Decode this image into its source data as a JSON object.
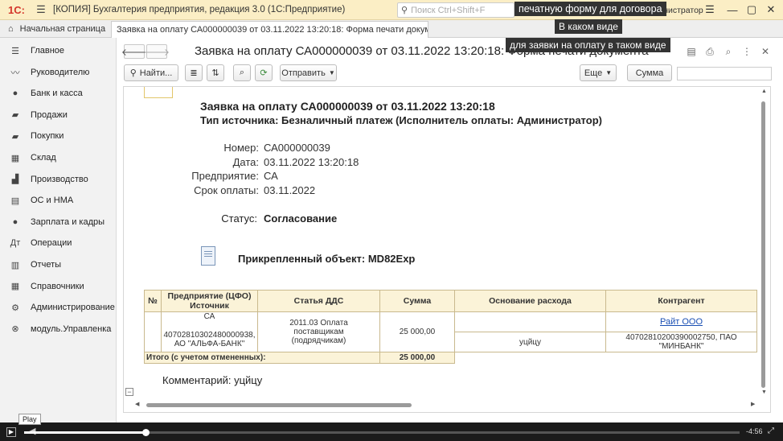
{
  "app": {
    "logo": "1С:",
    "window_title": "[КОПИЯ] Бухгалтерия предприятия, редакция 3.0  (1С:Предприятие)",
    "search_placeholder": "Поиск Ctrl+Shift+F",
    "user_label": "дминистратор"
  },
  "tabs": {
    "home": "Начальная страница",
    "document": "Заявка на оплату СА000000039 от 03.11.2022 13:20:18: Форма печати документа"
  },
  "sidebar": {
    "items": [
      {
        "label": "Главное",
        "icon": "☰"
      },
      {
        "label": "Руководителю",
        "icon": "〰"
      },
      {
        "label": "Банк и касса",
        "icon": "●"
      },
      {
        "label": "Продажи",
        "icon": "▰"
      },
      {
        "label": "Покупки",
        "icon": "▰"
      },
      {
        "label": "Склад",
        "icon": "▦"
      },
      {
        "label": "Производство",
        "icon": "▟"
      },
      {
        "label": "ОС и НМА",
        "icon": "▤"
      },
      {
        "label": "Зарплата и кадры",
        "icon": "●"
      },
      {
        "label": "Операции",
        "icon": "Дт"
      },
      {
        "label": "Отчеты",
        "icon": "▥"
      },
      {
        "label": "Справочники",
        "icon": "▦"
      },
      {
        "label": "Администрирование",
        "icon": "⚙"
      },
      {
        "label": "модуль.Управленка",
        "icon": "⊗"
      }
    ]
  },
  "form": {
    "title": "Заявка на оплату СА000000039 от 03.11.2022 13:20:18: Форма печати документа",
    "find_button": "Найти...",
    "send_button": "Отправить",
    "more_button": "Еще",
    "sum_button": "Сумма"
  },
  "report": {
    "heading": "Заявка на оплату СА000000039 от 03.11.2022 13:20:18",
    "subheading": "Тип источника: Безналичный платеж (Исполнитель оплаты: Администратор)",
    "fields": [
      {
        "label": "Номер:",
        "value": "СА000000039"
      },
      {
        "label": "Дата:",
        "value": "03.11.2022 13:20:18"
      },
      {
        "label": "Предприятие:",
        "value": "СА"
      },
      {
        "label": "Срок оплаты:",
        "value": "03.11.2022"
      }
    ],
    "status_label": "Статус:",
    "status_value": "Согласование",
    "attached_label": "Прикрепленный объект: MD82Exp",
    "table": {
      "headers": [
        "№",
        "Предприятие (ЦФО) Источник",
        "Статья ДДС",
        "Сумма",
        "Основание расхода",
        "Контрагент"
      ],
      "row": {
        "enterprise": "СА",
        "account": "40702810302480000938, АО \"АЛЬФА-БАНК\"",
        "article": "2011.03 Оплата поставщикам (подрядчикам)",
        "amount": "25 000,00",
        "reason": "уцйцу",
        "counterparty_name": "Райт ООО",
        "counterparty_account": "40702810200390002750, ПАО \"МИНБАНК\""
      },
      "total_label": "Итого (с учетом отмененных):",
      "total_amount": "25 000,00"
    },
    "comment": "Комментарий: уцйцу"
  },
  "overlays": {
    "caption1": "печатную форму для договора",
    "caption2": "В каком виде",
    "caption3": "для заявки на оплату в таком виде",
    "play_tooltip": "Play",
    "time_remaining": "-4:56",
    "progress_fraction": 0.17
  }
}
